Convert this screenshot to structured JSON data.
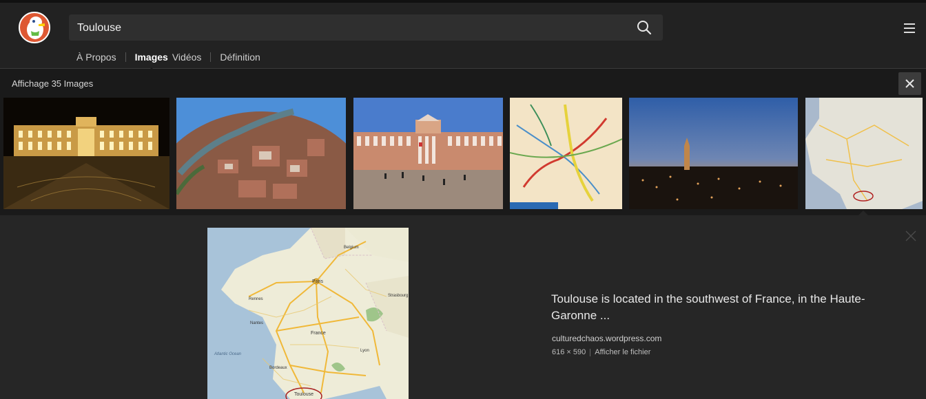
{
  "search": {
    "query": "Toulouse"
  },
  "nav": {
    "items": [
      {
        "label": "À Propos"
      },
      {
        "label": "Images"
      },
      {
        "label": "Vidéos"
      },
      {
        "label": "Définition"
      }
    ],
    "active": "Images"
  },
  "results": {
    "count_text": "Affichage 35 Images"
  },
  "thumbnails": [
    {
      "subject": "Capitole de Toulouse illuminated at night"
    },
    {
      "subject": "Fisheye aerial view of Toulouse and the Garonne"
    },
    {
      "subject": "Capitole de Toulouse facade by day"
    },
    {
      "subject": "Toulouse transit network map"
    },
    {
      "subject": "Toulouse skyline at dusk"
    },
    {
      "subject": "Road map of France with Toulouse circled",
      "selected": true
    }
  ],
  "detail": {
    "title": "Toulouse is located in the southwest of France, in the Haute-Garonne ...",
    "source": "culturedchaos.wordpress.com",
    "dimensions": "616 × 590",
    "open_file": "Afficher le fichier",
    "map_labels": {
      "paris": "Paris",
      "france": "France",
      "toulouse": "Toulouse",
      "ocean": "Atlantic Ocean",
      "belgium": "Belgium",
      "strasbourg": "Strasbourg",
      "rennes": "Rennes",
      "nantes": "Nantes",
      "lyon": "Lyon",
      "bordeaux": "Bordeaux"
    }
  },
  "colors": {
    "header_bg": "#222222",
    "page_bg": "#1c1c1c",
    "detail_bg": "#262626",
    "brand": "#de5833"
  },
  "icons": {
    "logo": "duckduckgo-logo",
    "search": "search-icon",
    "menu": "hamburger-menu-icon",
    "close": "close-icon"
  }
}
